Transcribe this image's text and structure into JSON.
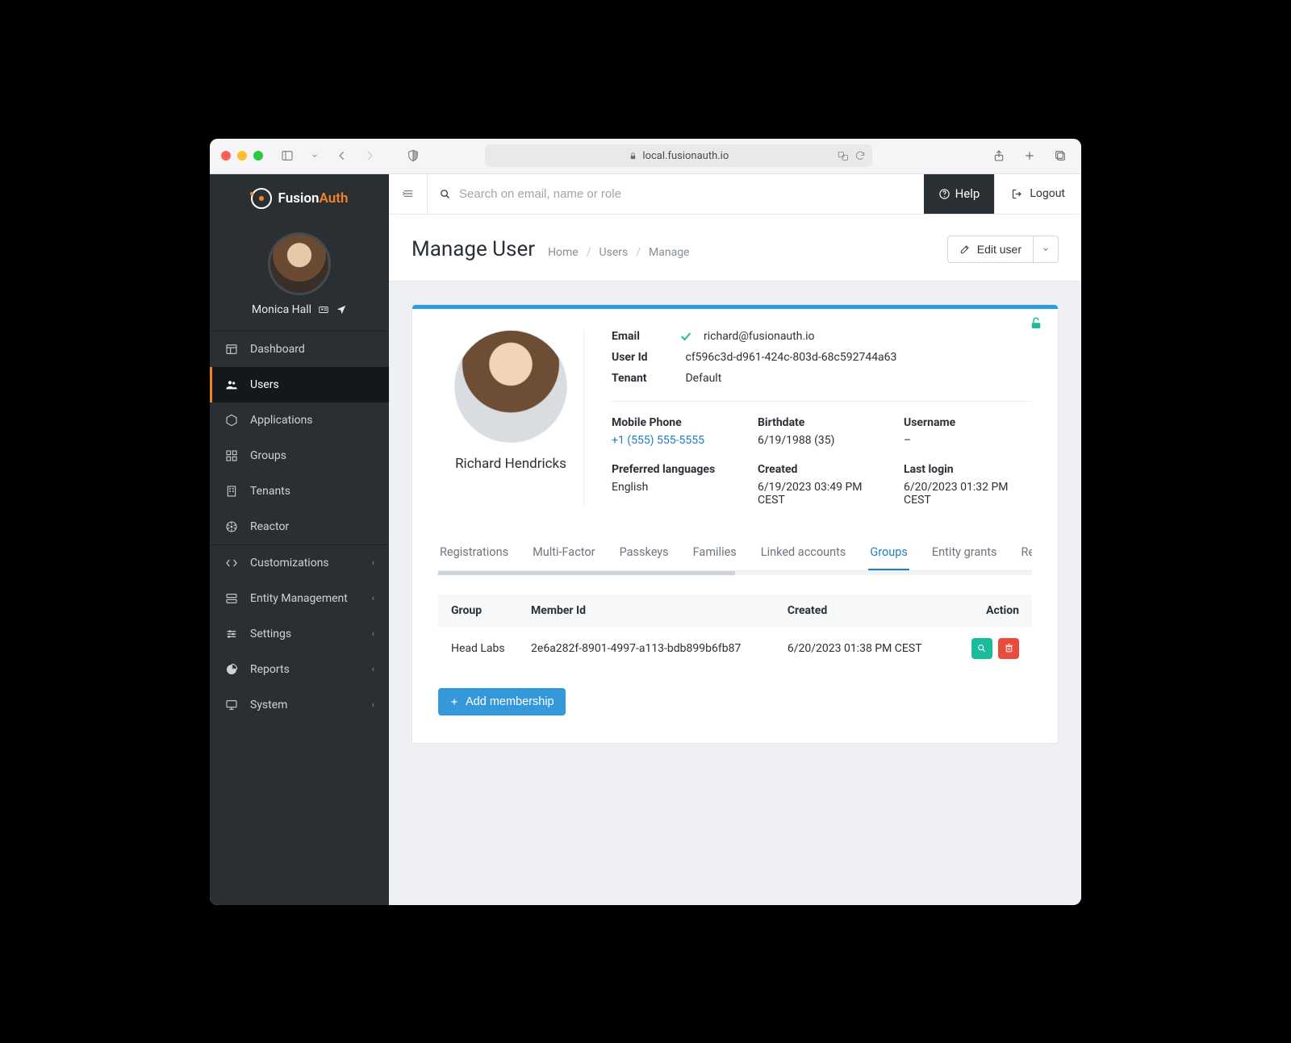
{
  "browser": {
    "url": "local.fusionauth.io"
  },
  "brand": {
    "part1": "Fusion",
    "part2": "Auth"
  },
  "profile_user": "Monica Hall",
  "sidebar_primary": [
    {
      "label": "Dashboard",
      "icon": "dashboard"
    },
    {
      "label": "Users",
      "icon": "users",
      "active": true
    },
    {
      "label": "Applications",
      "icon": "applications"
    },
    {
      "label": "Groups",
      "icon": "groups"
    },
    {
      "label": "Tenants",
      "icon": "tenants"
    },
    {
      "label": "Reactor",
      "icon": "reactor"
    }
  ],
  "sidebar_secondary": [
    {
      "label": "Customizations",
      "icon": "code"
    },
    {
      "label": "Entity Management",
      "icon": "server"
    },
    {
      "label": "Settings",
      "icon": "sliders"
    },
    {
      "label": "Reports",
      "icon": "chart"
    },
    {
      "label": "System",
      "icon": "monitor"
    }
  ],
  "topbar": {
    "search_placeholder": "Search on email, name or role",
    "help_label": "Help",
    "logout_label": "Logout"
  },
  "page": {
    "title": "Manage User",
    "breadcrumbs": [
      "Home",
      "Users",
      "Manage"
    ],
    "edit_button": "Edit user"
  },
  "user": {
    "display_name": "Richard Hendricks",
    "email_label": "Email",
    "email": "richard@fusionauth.io",
    "userid_label": "User Id",
    "userid": "cf596c3d-d961-424c-803d-68c592744a63",
    "tenant_label": "Tenant",
    "tenant": "Default",
    "fields": {
      "mobile_phone": {
        "label": "Mobile Phone",
        "value": "+1 (555) 555-5555",
        "link": true
      },
      "birthdate": {
        "label": "Birthdate",
        "value": "6/19/1988 (35)"
      },
      "username": {
        "label": "Username",
        "value": "–"
      },
      "pref_lang": {
        "label": "Preferred languages",
        "value": "English"
      },
      "created": {
        "label": "Created",
        "value": "6/19/2023 03:49 PM CEST"
      },
      "last_login": {
        "label": "Last login",
        "value": "6/20/2023 01:32 PM CEST"
      }
    }
  },
  "tabs": [
    "Registrations",
    "Multi-Factor",
    "Passkeys",
    "Families",
    "Linked accounts",
    "Groups",
    "Entity grants",
    "Re"
  ],
  "active_tab_index": 5,
  "groups_table": {
    "headers": [
      "Group",
      "Member Id",
      "Created",
      "Action"
    ],
    "rows": [
      {
        "group": "Head Labs",
        "member_id": "2e6a282f-8901-4997-a113-bdb899b6fb87",
        "created": "6/20/2023 01:38 PM CEST"
      }
    ]
  },
  "add_membership_label": "Add membership"
}
